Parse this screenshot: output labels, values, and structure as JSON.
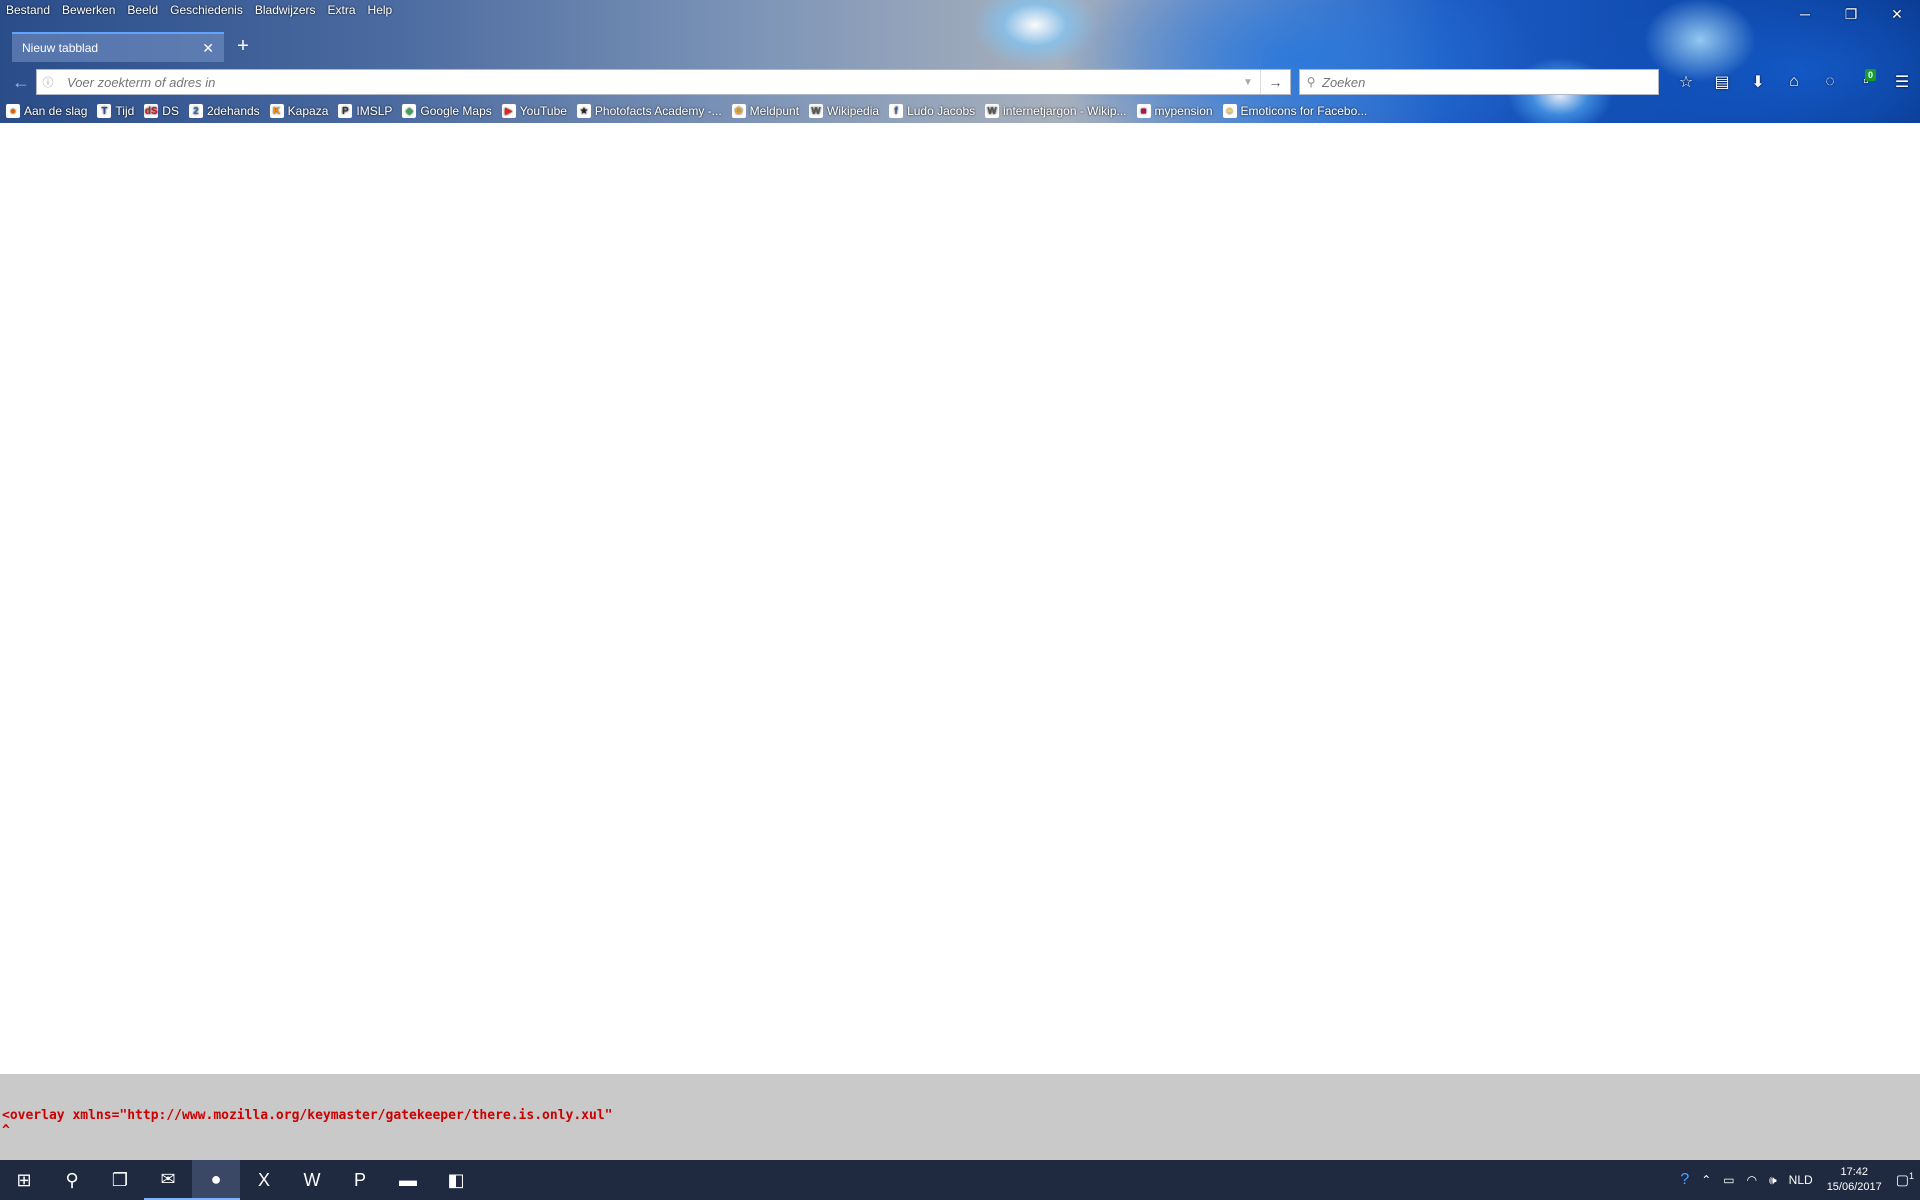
{
  "menu": [
    "Bestand",
    "Bewerken",
    "Beeld",
    "Geschiedenis",
    "Bladwijzers",
    "Extra",
    "Help"
  ],
  "window_controls": {
    "minimize": "─",
    "restore": "❐",
    "close": "✕"
  },
  "tab": {
    "title": "Nieuw tabblad",
    "close": "✕",
    "new_tab": "+"
  },
  "navbar": {
    "back": "←",
    "url_placeholder": "Voer zoekterm of adres in",
    "go": "→",
    "search_placeholder": "Zoeken",
    "badge_count": "0"
  },
  "bookmarks": [
    {
      "label": "Aan de slag",
      "icon": "firefox-icon",
      "glyph": "●",
      "color": "#e66000"
    },
    {
      "label": "Tijd",
      "icon": "tijd-icon",
      "glyph": "T",
      "color": "#2b4f9a"
    },
    {
      "label": "DS",
      "icon": "ds-icon",
      "glyph": "dS",
      "color": "#c4161c"
    },
    {
      "label": "2dehands",
      "icon": "2dehands-icon",
      "glyph": "2",
      "color": "#2c6fb5"
    },
    {
      "label": "Kapaza",
      "icon": "kapaza-icon",
      "glyph": "K",
      "color": "#f28c00"
    },
    {
      "label": "IMSLP",
      "icon": "imslp-icon",
      "glyph": "P",
      "color": "#333333"
    },
    {
      "label": "Google Maps",
      "icon": "maps-icon",
      "glyph": "◆",
      "color": "#34a853"
    },
    {
      "label": "YouTube",
      "icon": "youtube-icon",
      "glyph": "▶",
      "color": "#e62117"
    },
    {
      "label": "Photofacts Academy -...",
      "icon": "photofacts-icon",
      "glyph": "★",
      "color": "#222222"
    },
    {
      "label": "Meldpunt",
      "icon": "meldpunt-icon",
      "glyph": "✿",
      "color": "#f5a623"
    },
    {
      "label": "Wikipedia",
      "icon": "wikipedia-icon",
      "glyph": "W",
      "color": "#555555"
    },
    {
      "label": "Ludo Jacobs",
      "icon": "facebook-icon",
      "glyph": "f",
      "color": "#3b5998"
    },
    {
      "label": "internetjargon - Wikip...",
      "icon": "wikipedia-icon",
      "glyph": "W",
      "color": "#555555"
    },
    {
      "label": "mypension",
      "icon": "mypension-icon",
      "glyph": "■",
      "color": "#b0124e"
    },
    {
      "label": "Emoticons for Facebo...",
      "icon": "emoticon-icon",
      "glyph": "☺",
      "color": "#e0a800"
    }
  ],
  "error_text": {
    "line1": "<overlay xmlns=\"http://www.mozilla.org/keymaster/gatekeeper/there.is.only.xul\"",
    "line2": "^"
  },
  "taskbar": {
    "apps": [
      {
        "icon": "windows-start-icon",
        "glyph": "⊞"
      },
      {
        "icon": "search-icon",
        "glyph": "⚲"
      },
      {
        "icon": "task-view-icon",
        "glyph": "❐"
      },
      {
        "icon": "thunderbird-icon",
        "glyph": "✉"
      },
      {
        "icon": "firefox-icon",
        "glyph": "●"
      },
      {
        "icon": "excel-icon",
        "glyph": "X"
      },
      {
        "icon": "word-icon",
        "glyph": "W"
      },
      {
        "icon": "powerpoint-icon",
        "glyph": "P"
      },
      {
        "icon": "file-explorer-icon",
        "glyph": "▬"
      },
      {
        "icon": "app-icon",
        "glyph": "◧"
      }
    ],
    "language": "NLD",
    "time": "17:42",
    "date": "15/06/2017",
    "notification_count": "1"
  }
}
